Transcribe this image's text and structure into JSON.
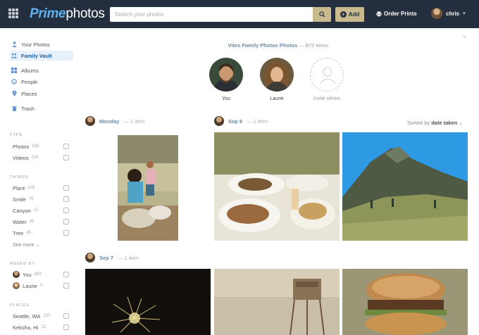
{
  "header": {
    "logo_prime": "Prime",
    "logo_photos": "photos",
    "search_placeholder": "Search your photos",
    "add_label": "Add",
    "order_label": "Order Prints",
    "user_name": "chris"
  },
  "sidebar": {
    "nav": [
      {
        "label": "Your Photos",
        "icon": "person-icon"
      },
      {
        "label": "Family Vault",
        "icon": "family-icon",
        "active": true
      },
      {
        "label": "Albums",
        "icon": "albums-icon"
      },
      {
        "label": "People",
        "icon": "people-icon"
      },
      {
        "label": "Places",
        "icon": "place-pin-icon"
      },
      {
        "label": "Trash",
        "icon": "trash-icon"
      }
    ],
    "type_head": "TYPE",
    "types": [
      {
        "label": "Photos",
        "count": "636"
      },
      {
        "label": "Videos",
        "count": "236"
      }
    ],
    "things_head": "THINGS",
    "things": [
      {
        "label": "Plant",
        "count": "129"
      },
      {
        "label": "Smile",
        "count": "76"
      },
      {
        "label": "Canyon",
        "count": "10"
      },
      {
        "label": "Water",
        "count": "48"
      },
      {
        "label": "Tree",
        "count": "45"
      }
    ],
    "see_more": "See more",
    "added_head": "ADDED BY",
    "added_by": [
      {
        "label": "You",
        "count": "869"
      },
      {
        "label": "Laurie",
        "count": "3"
      }
    ],
    "places_head": "PLACES",
    "places": [
      {
        "label": "Seattle, WA",
        "count": "137"
      },
      {
        "label": "Keksha, HI",
        "count": "22"
      }
    ]
  },
  "main": {
    "vault_name": "Vites Family Photos Photos",
    "vault_count": "— 872 items",
    "members": [
      {
        "label": "You"
      },
      {
        "label": "Laurie"
      },
      {
        "label": "Invite others"
      }
    ],
    "sorted_prefix": "Sorted by",
    "sorted_value": "date taken",
    "groups": [
      {
        "date": "Monday",
        "count": "— 1 item"
      },
      {
        "date": "Sep 8",
        "count": "— 1 item"
      },
      {
        "date": "Sep 7",
        "count": "— 1 item"
      }
    ]
  },
  "colors": {
    "topbar": "#232f3e",
    "accent": "#c9b98f",
    "link": "#6b8aa8",
    "active_bg": "#e7f1fb"
  }
}
